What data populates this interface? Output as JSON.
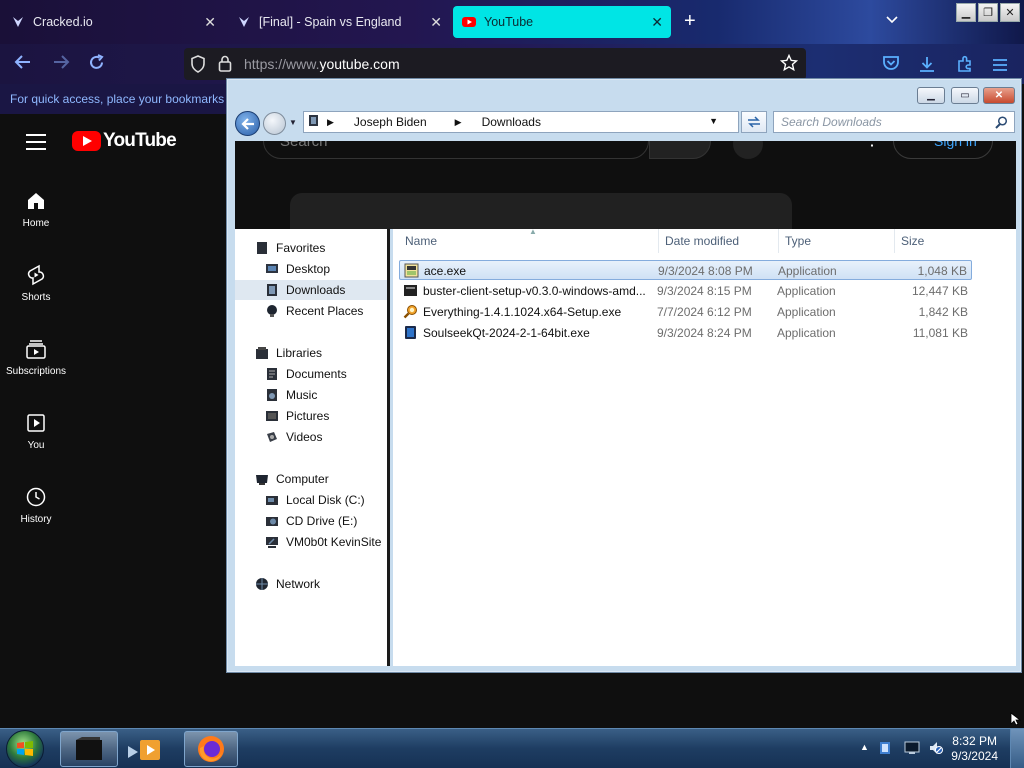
{
  "browser": {
    "tabs": [
      {
        "title": "Cracked.io",
        "active": false
      },
      {
        "title": "[Final] - Spain vs England",
        "active": false
      },
      {
        "title": "YouTube",
        "active": true
      }
    ],
    "new_tab": "+",
    "tab_list": "⌄",
    "url_prefix": "https://www.",
    "url_host": "youtube.com",
    "bookmarks_hint": "For quick access, place your bookmarks here on the bookmarks toolbar."
  },
  "youtube": {
    "brand": "YouTube",
    "nav": [
      "Home",
      "Shorts",
      "Subscriptions",
      "You",
      "History"
    ],
    "search_placeholder": "Search",
    "sign_in": "Sign in",
    "more": "⋮"
  },
  "explorer": {
    "breadcrumb": [
      "Joseph Biden",
      "Downloads"
    ],
    "search_placeholder": "Search Downloads",
    "sidebar": {
      "favorites_header": "Favorites",
      "favorites": [
        "Desktop",
        "Downloads",
        "Recent Places"
      ],
      "libraries_header": "Libraries",
      "libraries": [
        "Documents",
        "Music",
        "Pictures",
        "Videos"
      ],
      "computer_header": "Computer",
      "computer": [
        "Local Disk (C:)",
        "CD Drive (E:)",
        "VM0b0t KevinSite"
      ],
      "network": "Network"
    },
    "columns": [
      "Name",
      "Date modified",
      "Type",
      "Size"
    ],
    "files": [
      {
        "name": "ace.exe",
        "date": "9/3/2024 8:08 PM",
        "type": "Application",
        "size": "1,048 KB",
        "selected": true
      },
      {
        "name": "buster-client-setup-v0.3.0-windows-amd...",
        "date": "9/3/2024 8:15 PM",
        "type": "Application",
        "size": "12,447 KB",
        "selected": false
      },
      {
        "name": "Everything-1.4.1.1024.x64-Setup.exe",
        "date": "7/7/2024 6:12 PM",
        "type": "Application",
        "size": "1,842 KB",
        "selected": false
      },
      {
        "name": "SoulseekQt-2024-2-1-64bit.exe",
        "date": "9/3/2024 8:24 PM",
        "type": "Application",
        "size": "11,081 KB",
        "selected": false
      }
    ]
  },
  "taskbar": {
    "time": "8:32 PM",
    "date": "9/3/2024"
  }
}
